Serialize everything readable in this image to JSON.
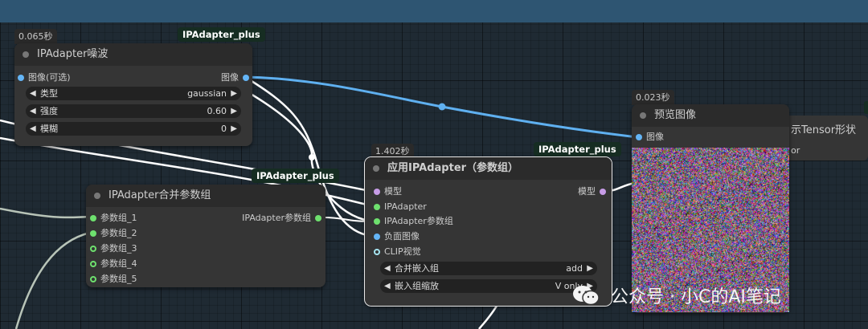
{
  "nodes": {
    "noise": {
      "time": "0.065秒",
      "badge": "IPAdapter_plus",
      "title": "IPAdapter噪波",
      "input_image": "图像(可选)",
      "output_image": "图像",
      "widgets": [
        {
          "name": "类型",
          "value": "gaussian"
        },
        {
          "name": "强度",
          "value": "0.60"
        },
        {
          "name": "模糊",
          "value": "0"
        }
      ]
    },
    "combine": {
      "badge": "IPAdapter_plus",
      "title": "IPAdapter合并参数组",
      "inputs": [
        "参数组_1",
        "参数组_2",
        "参数组_3",
        "参数组_4",
        "参数组_5"
      ],
      "output": "IPAdapter参数组"
    },
    "apply": {
      "time": "1.402秒",
      "badge": "IPAdapter_plus",
      "title": "应用IPAdapter（参数组）",
      "inputs": [
        "模型",
        "IPAdapter",
        "IPAdapter参数组",
        "负面图像",
        "CLIP视觉"
      ],
      "output": "模型",
      "widgets": [
        {
          "name": "合并嵌入组",
          "value": "add"
        },
        {
          "name": "嵌入组缩放",
          "value": "V only"
        }
      ]
    },
    "preview": {
      "time": "0.023秒",
      "title": "预览图像",
      "input": "图像"
    },
    "hidden_node": {
      "title_fragment": "示Tensor形状",
      "text_fragment": "or"
    }
  },
  "icons": {
    "arrow_left": "◀",
    "arrow_right": "▶"
  },
  "watermark": {
    "text": "公众号 · 小C的AI笔记"
  },
  "colors": {
    "image_wire": "#5fb0f0",
    "white_wire": "#ffffff",
    "gray_wire": "#b8c4b8",
    "model_port": "#c79ce6",
    "ipadapter_port": "#6ee06e",
    "image_port": "#64b5f6",
    "clip_port": "#a6e4f0"
  }
}
